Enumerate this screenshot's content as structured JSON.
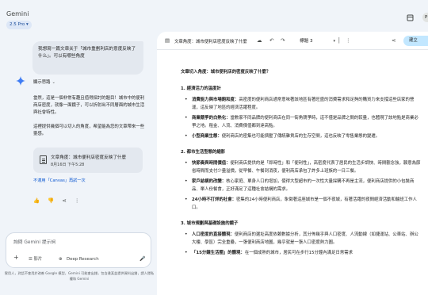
{
  "app": {
    "brand": "Gemini",
    "model": "2.5 Pro ▾"
  },
  "topbar": {
    "right_chip": "P"
  },
  "chat": {
    "user_message": "我想寫一篇文章关于「城市重劃利店的意度反映了什么」。可以有哪些角度",
    "thinking_label": "顯示思路",
    "response_para1": "當然，這是一個非常有趣且值得探討的題目！城市中的便利商店密度，就像一面鏡子，可以折射出不同層面的城市生活與社會特性。",
    "response_para2": "這裡提供幾個可以切入的角度，希望能為您的文章帶來一些靈感。",
    "doc_card": {
      "title": "文章角度：城市便利店密度反映了什麼",
      "time": "8月16日 下午5:28"
    },
    "canvas_link": "不適用「Canvas」再試一次",
    "prompt_placeholder": "詢問 Gemini 提示詞",
    "tools": {
      "add": "+",
      "files": "☰ 影片",
      "deep_research": "Deep Research",
      "mic": "🎤"
    },
    "disclaimer": "實用人，對話不會用於改善 Google 模型，Gemini 可能會出錯，包含違某並提供資料出錯，請人隱私權和 Gemini"
  },
  "doc": {
    "title": "文章角度：城市便利店密度反映了什麼",
    "style": "標題 3",
    "share": "建立",
    "intro": "文章切入角度：城市便利店的密度反映了什麼？",
    "sections": [
      {
        "heading": "1. 經濟活力的溫度計",
        "items": [
          {
            "bold": "消費能力與市場飽和度：",
            "text": "高密度的便利商店通常意味著該地區有著旺盛的消費需求和足夠的購買力來支撐這些店家的營運，這反映了地區的經濟活躍程度。"
          },
          {
            "bold": "商業競爭的白熱化：",
            "text": "當數家不同品牌的便利商店在同一街角競爭時，這不僅是品牌之間的較量，也體現了該地點是商業必爭之地。租金、人流、消費價值都到達高點。"
          },
          {
            "bold": "小型商業生態：",
            "text": "便利商店的密集也可能擠壓了傳統雜貨店的生存空間，這也反映了零售業態的變遷。"
          }
        ]
      },
      {
        "heading": "2. 都市生活型態的縮影",
        "items": [
          {
            "bold": "快節奏與時間價值：",
            "text": "便利商店提供的是「即時性」和「便利性」，高密度代表了居民的生活步調快、時間觀念強，願意為節省時間而支付少量溢價，從早餐、午餐到消夜，便利商店承包了許多上班族的一日三餐。"
          },
          {
            "bold": "家戶結構的改變：",
            "text": "核心家庭、單身人口的增加，使得大型超市的一次性大量採購不再是主流，便利商店提供的小包裝商品、單人份餐食，正好滿足了這種社會結構的需求。"
          },
          {
            "bold": "24小時不打烊的社會：",
            "text": "密集的24小時便利商店，象徵著這座城市是一個不夜城，有著活躍的夜間經濟活動和輪班工作人口。"
          }
        ]
      },
      {
        "heading": "3. 城市規劃與基礎設施的鏡子",
        "items": [
          {
            "bold": "人口密度的直接體現：",
            "text": "便利商店的選址高度依賴數據分析，其分佈幾乎與人口密度、人流動線（如捷運站、公車站、辦公大樓、學區）完全重疊，一張便利商店地圖，幾乎就是一張人口密度熱力圖。"
          },
          {
            "bold": "「15分鐘生活圈」的體現：",
            "text": "在一個成熟的城市，居民可在步行15分鐘內滿足日常需求"
          }
        ]
      }
    ]
  }
}
